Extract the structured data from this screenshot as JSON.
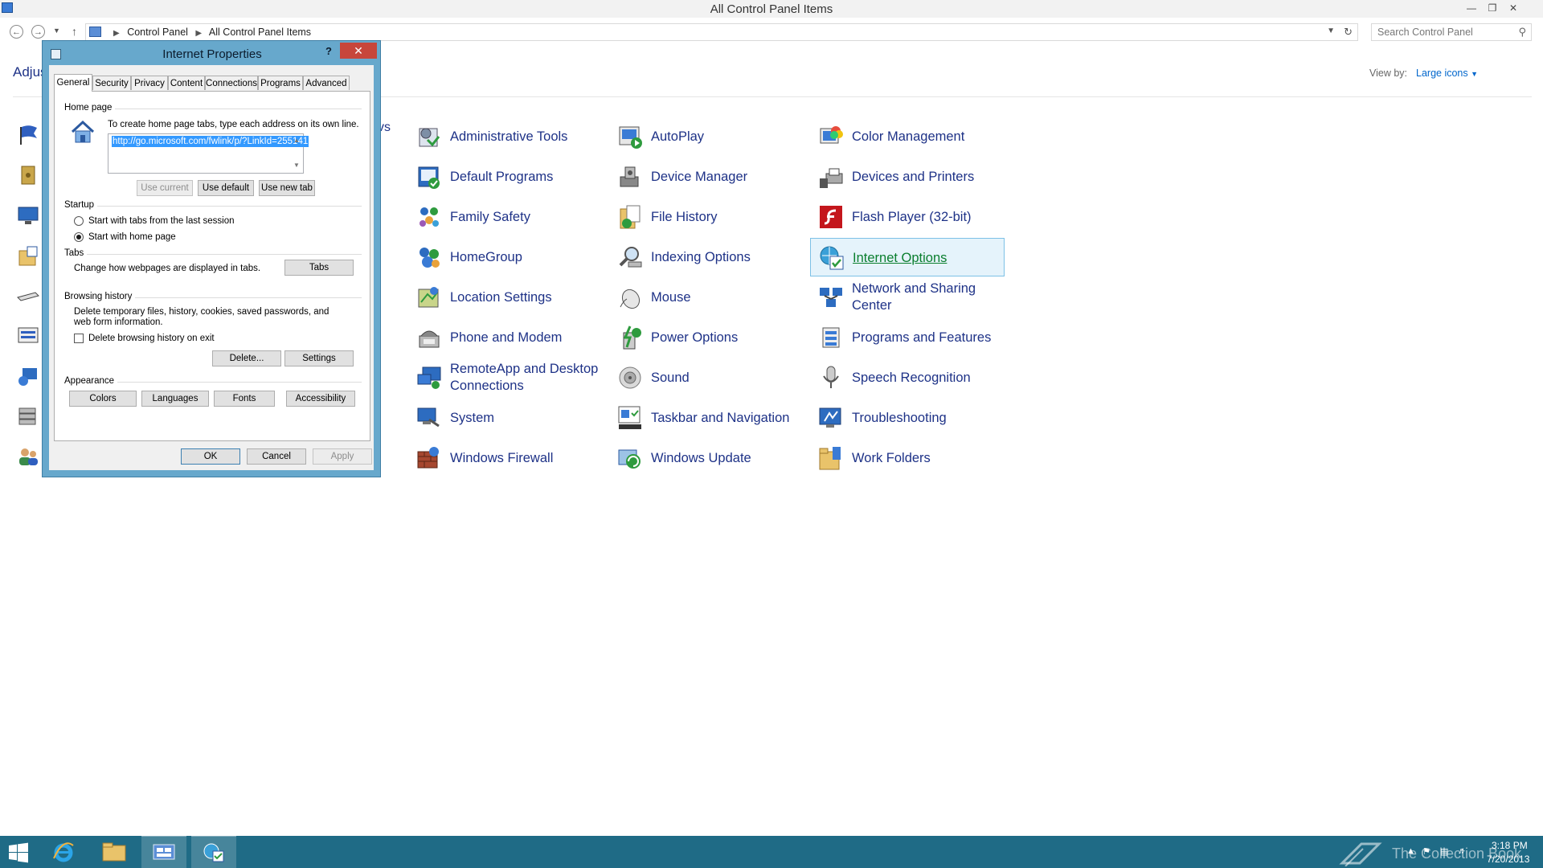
{
  "window": {
    "title": "All Control Panel Items"
  },
  "address": {
    "crumbs": [
      "Control Panel",
      "All Control Panel Items"
    ],
    "search_placeholder": "Search Control Panel"
  },
  "content": {
    "heading_partial": "Adjus",
    "partial_text": "vs",
    "view_by_label": "View by:",
    "view_by_value": "Large icons"
  },
  "items": [
    {
      "label": "Administrative Tools",
      "icon": "administrative-tools-icon"
    },
    {
      "label": "AutoPlay",
      "icon": "autoplay-icon"
    },
    {
      "label": "Color Management",
      "icon": "color-management-icon"
    },
    {
      "label": "Default Programs",
      "icon": "default-programs-icon"
    },
    {
      "label": "Device Manager",
      "icon": "device-manager-icon"
    },
    {
      "label": "Devices and Printers",
      "icon": "devices-printers-icon"
    },
    {
      "label": "Family Safety",
      "icon": "family-safety-icon"
    },
    {
      "label": "File History",
      "icon": "file-history-icon"
    },
    {
      "label": "Flash Player (32-bit)",
      "icon": "flash-player-icon"
    },
    {
      "label": "HomeGroup",
      "icon": "homegroup-icon"
    },
    {
      "label": "Indexing Options",
      "icon": "indexing-options-icon"
    },
    {
      "label": "Internet Options",
      "icon": "internet-options-icon"
    },
    {
      "label": "Location Settings",
      "icon": "location-settings-icon"
    },
    {
      "label": "Mouse",
      "icon": "mouse-icon"
    },
    {
      "label": "Network and Sharing Center",
      "icon": "network-sharing-icon"
    },
    {
      "label": "Phone and Modem",
      "icon": "phone-modem-icon"
    },
    {
      "label": "Power Options",
      "icon": "power-options-icon"
    },
    {
      "label": "Programs and Features",
      "icon": "programs-features-icon"
    },
    {
      "label": "RemoteApp and Desktop Connections",
      "icon": "remoteapp-icon"
    },
    {
      "label": "Sound",
      "icon": "sound-icon"
    },
    {
      "label": "Speech Recognition",
      "icon": "speech-recognition-icon"
    },
    {
      "label": "System",
      "icon": "system-icon"
    },
    {
      "label": "Taskbar and Navigation",
      "icon": "taskbar-navigation-icon"
    },
    {
      "label": "Troubleshooting",
      "icon": "troubleshooting-icon"
    },
    {
      "label": "Windows Firewall",
      "icon": "windows-firewall-icon"
    },
    {
      "label": "Windows Update",
      "icon": "windows-update-icon"
    },
    {
      "label": "Work Folders",
      "icon": "work-folders-icon"
    }
  ],
  "selected_item": "Internet Options",
  "dialog": {
    "title": "Internet Properties",
    "help": "?",
    "tabs": [
      "General",
      "Security",
      "Privacy",
      "Content",
      "Connections",
      "Programs",
      "Advanced"
    ],
    "active_tab": "General",
    "home_page": {
      "group": "Home page",
      "instructions": "To create home page tabs, type each address on its own line.",
      "url": "http://go.microsoft.com/fwlink/p/?LinkId=255141",
      "use_current": "Use current",
      "use_default": "Use default",
      "use_new_tab": "Use new tab"
    },
    "startup": {
      "group": "Startup",
      "option_last_session": "Start with tabs from the last session",
      "option_home_page": "Start with home page",
      "selected": "Start with home page"
    },
    "tabs_group": {
      "group": "Tabs",
      "description": "Change how webpages are displayed in tabs.",
      "button": "Tabs"
    },
    "browsing_history": {
      "group": "Browsing history",
      "description": "Delete temporary files, history, cookies, saved passwords, and web form information.",
      "delete_on_exit": "Delete browsing history on exit",
      "delete_on_exit_checked": false,
      "delete": "Delete...",
      "settings": "Settings"
    },
    "appearance": {
      "group": "Appearance",
      "colors": "Colors",
      "languages": "Languages",
      "fonts": "Fonts",
      "accessibility": "Accessibility"
    },
    "ok": "OK",
    "cancel": "Cancel",
    "apply": "Apply"
  },
  "taskbar": {
    "apps": [
      "Internet Explorer",
      "File Explorer",
      "Control Panel",
      "Internet Properties"
    ],
    "watermark": "The Collection Book",
    "time": "3:18 PM",
    "date": "7/20/2013"
  },
  "colors": {
    "link": "#1e3287",
    "taskbar": "#1f6b86",
    "dialog_frame": "#67a8cc",
    "close_red": "#c7463b",
    "selection": "#3399ff"
  }
}
